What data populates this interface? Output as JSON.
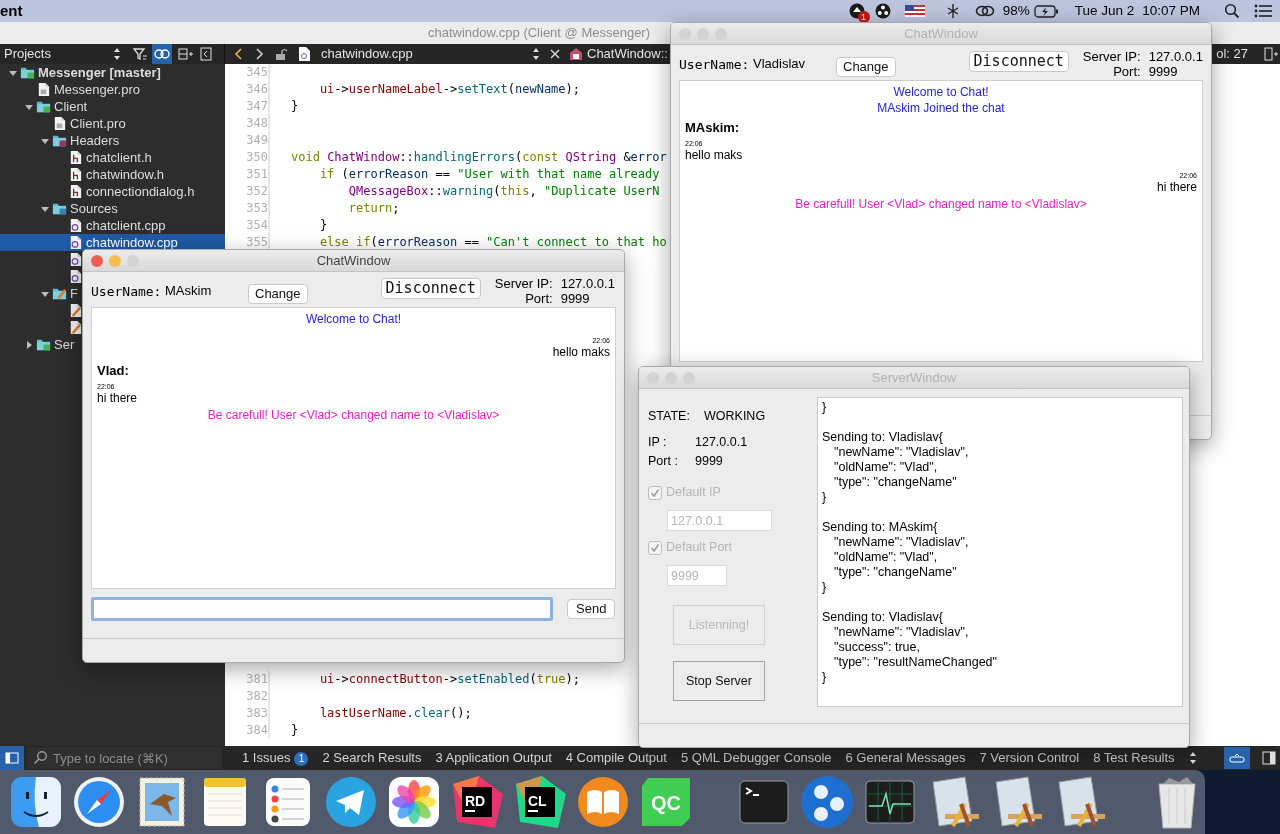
{
  "menubar": {
    "app_name": "ent",
    "notification_badge": "1",
    "battery": "98%",
    "date": "Tue Jun 2",
    "time": "10:07 PM"
  },
  "ide": {
    "title": "chatwindow.cpp (Client @ Messenger)",
    "sidebar_title": "Projects",
    "editor_file": "chatwindow.cpp",
    "symbol": "ChatWindow::",
    "cursor": "ol: 27",
    "tree": [
      {
        "label": "Messenger [master]",
        "kind": "project",
        "expanded": true,
        "selected": false,
        "children": [
          {
            "label": "Messenger.pro",
            "kind": "pro",
            "selected": false
          },
          {
            "label": "Client",
            "kind": "folder",
            "expanded": true,
            "selected": false,
            "children": [
              {
                "label": "Client.pro",
                "kind": "pro",
                "selected": false
              },
              {
                "label": "Headers",
                "kind": "headers",
                "expanded": true,
                "selected": false,
                "children": [
                  {
                    "label": "chatclient.h",
                    "kind": "header",
                    "selected": false
                  },
                  {
                    "label": "chatwindow.h",
                    "kind": "header",
                    "selected": false
                  },
                  {
                    "label": "connectiondialog.h",
                    "kind": "header",
                    "selected": false
                  }
                ]
              },
              {
                "label": "Sources",
                "kind": "sources",
                "expanded": true,
                "selected": false,
                "children": [
                  {
                    "label": "chatclient.cpp",
                    "kind": "source",
                    "selected": false
                  },
                  {
                    "label": "chatwindow.cpp",
                    "kind": "source",
                    "selected": true
                  },
                  {
                    "kind": "source",
                    "selected": false
                  },
                  {
                    "kind": "source",
                    "selected": false
                  }
                ]
              },
              {
                "label": "F",
                "kind": "forms",
                "expanded": true,
                "selected": false,
                "children": [
                  {
                    "kind": "form",
                    "selected": false
                  },
                  {
                    "kind": "form",
                    "selected": false
                  }
                ]
              }
            ]
          },
          {
            "label": "Ser",
            "kind": "folder",
            "expanded": false,
            "selected": false
          }
        ]
      }
    ],
    "code_top": [
      {
        "number": "345"
      },
      {
        "number": "346",
        "tokens": [
          {
            "text": "    ui",
            "kind": "member"
          },
          {
            "text": "->",
            "kind": "plain"
          },
          {
            "text": "userNameLabel",
            "kind": "member"
          },
          {
            "text": "->",
            "kind": "plain"
          },
          {
            "text": "setText",
            "kind": "function"
          },
          {
            "text": "(",
            "kind": "plain"
          },
          {
            "text": "newName",
            "kind": "variable"
          },
          {
            "text": ");",
            "kind": "plain"
          }
        ]
      },
      {
        "number": "347",
        "tokens": [
          {
            "text": "}",
            "kind": "plain"
          }
        ]
      },
      {
        "number": "348"
      },
      {
        "number": "349"
      },
      {
        "number": "350",
        "tokens": [
          {
            "text": "void ",
            "kind": "keyword"
          },
          {
            "text": "ChatWindow",
            "kind": "type"
          },
          {
            "text": "::",
            "kind": "plain"
          },
          {
            "text": "handlingErrors",
            "kind": "function"
          },
          {
            "text": "(",
            "kind": "plain"
          },
          {
            "text": "const ",
            "kind": "keyword"
          },
          {
            "text": "QString",
            "kind": "type"
          },
          {
            "text": " &",
            "kind": "plain"
          },
          {
            "text": "error",
            "kind": "variable"
          }
        ]
      },
      {
        "number": "351",
        "tokens": [
          {
            "text": "    if",
            "kind": "keyword"
          },
          {
            "text": " (",
            "kind": "plain"
          },
          {
            "text": "errorReason",
            "kind": "variable"
          },
          {
            "text": " == ",
            "kind": "plain"
          },
          {
            "text": "\"User with that name already",
            "kind": "string"
          }
        ]
      },
      {
        "number": "352",
        "tokens": [
          {
            "text": "        QMessageBox",
            "kind": "type"
          },
          {
            "text": "::",
            "kind": "plain"
          },
          {
            "text": "warning",
            "kind": "function"
          },
          {
            "text": "(",
            "kind": "plain"
          },
          {
            "text": "this",
            "kind": "keyword"
          },
          {
            "text": ", ",
            "kind": "plain"
          },
          {
            "text": "\"Duplicate UserN",
            "kind": "string"
          }
        ]
      },
      {
        "number": "353",
        "tokens": [
          {
            "text": "        return",
            "kind": "keyword"
          },
          {
            "text": ";",
            "kind": "plain"
          }
        ]
      },
      {
        "number": "354",
        "tokens": [
          {
            "text": "    }",
            "kind": "plain"
          }
        ]
      },
      {
        "number": "355",
        "tokens": [
          {
            "text": "    else if",
            "kind": "keyword"
          },
          {
            "text": "(",
            "kind": "plain"
          },
          {
            "text": "errorReason",
            "kind": "variable"
          },
          {
            "text": " == ",
            "kind": "plain"
          },
          {
            "text": "\"Can't connect to that ho",
            "kind": "string"
          }
        ]
      }
    ],
    "code_bottom": [
      {
        "number": "381",
        "tokens": [
          {
            "text": "    ui",
            "kind": "member"
          },
          {
            "text": "->",
            "kind": "plain"
          },
          {
            "text": "connectButton",
            "kind": "member"
          },
          {
            "text": "->",
            "kind": "plain"
          },
          {
            "text": "setEnabled",
            "kind": "function"
          },
          {
            "text": "(",
            "kind": "plain"
          },
          {
            "text": "true",
            "kind": "keyword"
          },
          {
            "text": ");",
            "kind": "plain"
          }
        ]
      },
      {
        "number": "382"
      },
      {
        "number": "383",
        "tokens": [
          {
            "text": "    lastUserName",
            "kind": "member"
          },
          {
            "text": ".",
            "kind": "plain"
          },
          {
            "text": "clear",
            "kind": "function"
          },
          {
            "text": "();",
            "kind": "plain"
          }
        ]
      },
      {
        "number": "384",
        "tokens": [
          {
            "text": "}",
            "kind": "plain"
          }
        ]
      }
    ],
    "locator": {
      "placeholder": "Type to locate (⌘K)"
    },
    "output_tabs": [
      {
        "number": "1",
        "label": "Issues",
        "badge": "1",
        "selected": false
      },
      {
        "number": "2",
        "label": "Search Results",
        "selected": false
      },
      {
        "number": "3",
        "label": "Application Output",
        "selected": false
      },
      {
        "number": "4",
        "label": "Compile Output",
        "selected": false
      },
      {
        "number": "5",
        "label": "QML Debugger Console",
        "selected": false
      },
      {
        "number": "6",
        "label": "General Messages",
        "selected": false
      },
      {
        "number": "7",
        "label": "Version Control",
        "selected": false
      },
      {
        "number": "8",
        "label": "Test Results",
        "selected": false
      }
    ]
  },
  "chat_windows": [
    {
      "title": "ChatWindow",
      "active": false,
      "username_label": "UserName:",
      "username": "Vladislav",
      "change_button": "Change",
      "disconnect_button": "Disconnect",
      "server_ip_label": "Server IP:",
      "server_ip": "127.0.0.1",
      "port_label": "Port:",
      "port": "9999",
      "messages": [
        {
          "kind": "system",
          "text": "Welcome to Chat!"
        },
        {
          "kind": "system",
          "text": "MAskim Joined the chat"
        },
        {
          "kind": "incoming",
          "sender": "MAskim:",
          "time": "22:06",
          "text": "hello maks"
        },
        {
          "kind": "outgoing",
          "time": "22:06",
          "text": "hi there"
        },
        {
          "kind": "notice",
          "text": "Be carefull! User <Vlad> changed name to <Vladislav>"
        }
      ]
    },
    {
      "title": "ChatWindow",
      "active": true,
      "username_label": "UserName:",
      "username": "MAskim",
      "change_button": "Change",
      "disconnect_button": "Disconnect",
      "server_ip_label": "Server IP:",
      "server_ip": "127.0.0.1",
      "port_label": "Port:",
      "port": "9999",
      "messages": [
        {
          "kind": "system",
          "text": "Welcome to Chat!"
        },
        {
          "kind": "outgoing",
          "time": "22:06",
          "text": "hello maks"
        },
        {
          "kind": "incoming",
          "sender": "Vlad:",
          "time": "22:06",
          "text": "hi there"
        },
        {
          "kind": "notice",
          "text": "Be carefull! User <Vlad> changed name to <Vladislav>"
        }
      ],
      "input": {
        "focused": true
      },
      "send_button": "Send"
    }
  ],
  "server_window": {
    "title": "ServerWindow",
    "active": false,
    "state_label": "STATE:",
    "state": "WORKING",
    "ip_label": "IP :",
    "ip": "127.0.0.1",
    "port_label": "Port :",
    "port": "9999",
    "options": [
      {
        "label": "Default IP",
        "checked": true,
        "disabled": true,
        "value": "127.0.0.1"
      },
      {
        "label": "Default Port",
        "checked": true,
        "disabled": true,
        "value": "9999"
      }
    ],
    "buttons": [
      {
        "label": "Listenning!",
        "disabled": true
      },
      {
        "label": "Stop Server",
        "disabled": false
      }
    ],
    "log": [
      {
        "footer": "}"
      },
      {
        "header": "Sending to: Vladislav{",
        "fields": [
          "\"newName\": \"Vladislav\",",
          "\"oldName\": \"Vlad\",",
          "\"type\": \"changeName\""
        ],
        "footer": "}"
      },
      {
        "header": "Sending to: MAskim{",
        "fields": [
          "\"newName\": \"Vladislav\",",
          "\"oldName\": \"Vlad\",",
          "\"type\": \"changeName\""
        ],
        "footer": "}"
      },
      {
        "header": "Sending to: Vladislav{",
        "fields": [
          "\"newName\": \"Vladislav\",",
          "\"success\": true,",
          "\"type\": \"resultNameChanged\""
        ],
        "footer": "}"
      }
    ]
  },
  "dock": [
    {
      "kind": "finder"
    },
    {
      "kind": "safari"
    },
    {
      "kind": "mail"
    },
    {
      "kind": "notes"
    },
    {
      "kind": "reminders"
    },
    {
      "kind": "telegram"
    },
    {
      "kind": "photos"
    },
    {
      "kind": "jetbrains",
      "label": "RD",
      "color": "#e8356d"
    },
    {
      "kind": "jetbrains",
      "label": "CL",
      "color": "#21d789"
    },
    {
      "kind": "books"
    },
    {
      "kind": "qt",
      "label": "QC"
    },
    {
      "kind": "divider"
    },
    {
      "kind": "terminal"
    },
    {
      "kind": "orb"
    },
    {
      "kind": "activity"
    },
    {
      "kind": "xdoc"
    },
    {
      "kind": "xdoc"
    },
    {
      "kind": "xdoc"
    },
    {
      "kind": "divider"
    },
    {
      "kind": "trash"
    }
  ]
}
